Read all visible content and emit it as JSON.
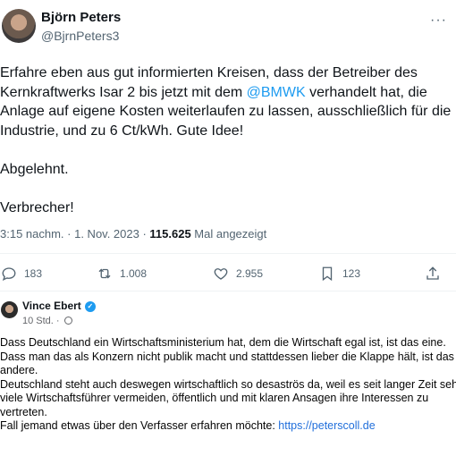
{
  "tweet": {
    "author_name": "Björn Peters",
    "author_handle": "@BjrnPeters3",
    "more_label": "···",
    "lines": [
      "Erfahre eben aus gut informierten Kreisen, dass der Betreiber des",
      "Kernkraftwerks Isar 2 bis jetzt mit dem ",
      "@BMWK",
      " verhandelt hat, die",
      "Anlage auf eigene Kosten weiterlaufen zu lassen, ausschließlich für die",
      "Industrie, und zu 6 Ct/kWh. Gute Idee!",
      "Abgelehnt.",
      "Verbrecher!"
    ],
    "time_date": "3:15 nachm. · 1. Nov. 2023 · ",
    "views_count": "115.625",
    "views_label": " Mal angezeigt",
    "actions": {
      "replies": "183",
      "reposts": "1.008",
      "likes": "2.955",
      "bookmarks": "123"
    },
    "icons": [
      "reply-icon",
      "repost-icon",
      "like-icon",
      "bookmark-icon",
      "share-icon"
    ],
    "colors": {
      "mention": "#1d9bf0",
      "secondary": "#536471"
    }
  },
  "comment": {
    "author_name": "Vince Ebert",
    "time": "10 Std. · ",
    "lines": [
      "Dass Deutschland ein Wirtschaftsministerium hat, dem die Wirtschaft egal ist, ist das eine.",
      "Dass man das als Konzern nicht publik macht und stattdessen lieber die Klappe hält, ist das",
      "andere.",
      "Deutschland steht auch deswegen wirtschaftlich so desaströs da, weil es seit langer Zeit sehr",
      "viele Wirtschaftsführer vermeiden, öffentlich und mit klaren Ansagen ihre Interessen zu",
      "vertreten.",
      "Fall jemand etwas über den Verfasser erfahren möchte: "
    ],
    "link": "https://peterscoll.de",
    "colors": {
      "link": "#216fdb",
      "verified": "#1d9bf0"
    }
  }
}
